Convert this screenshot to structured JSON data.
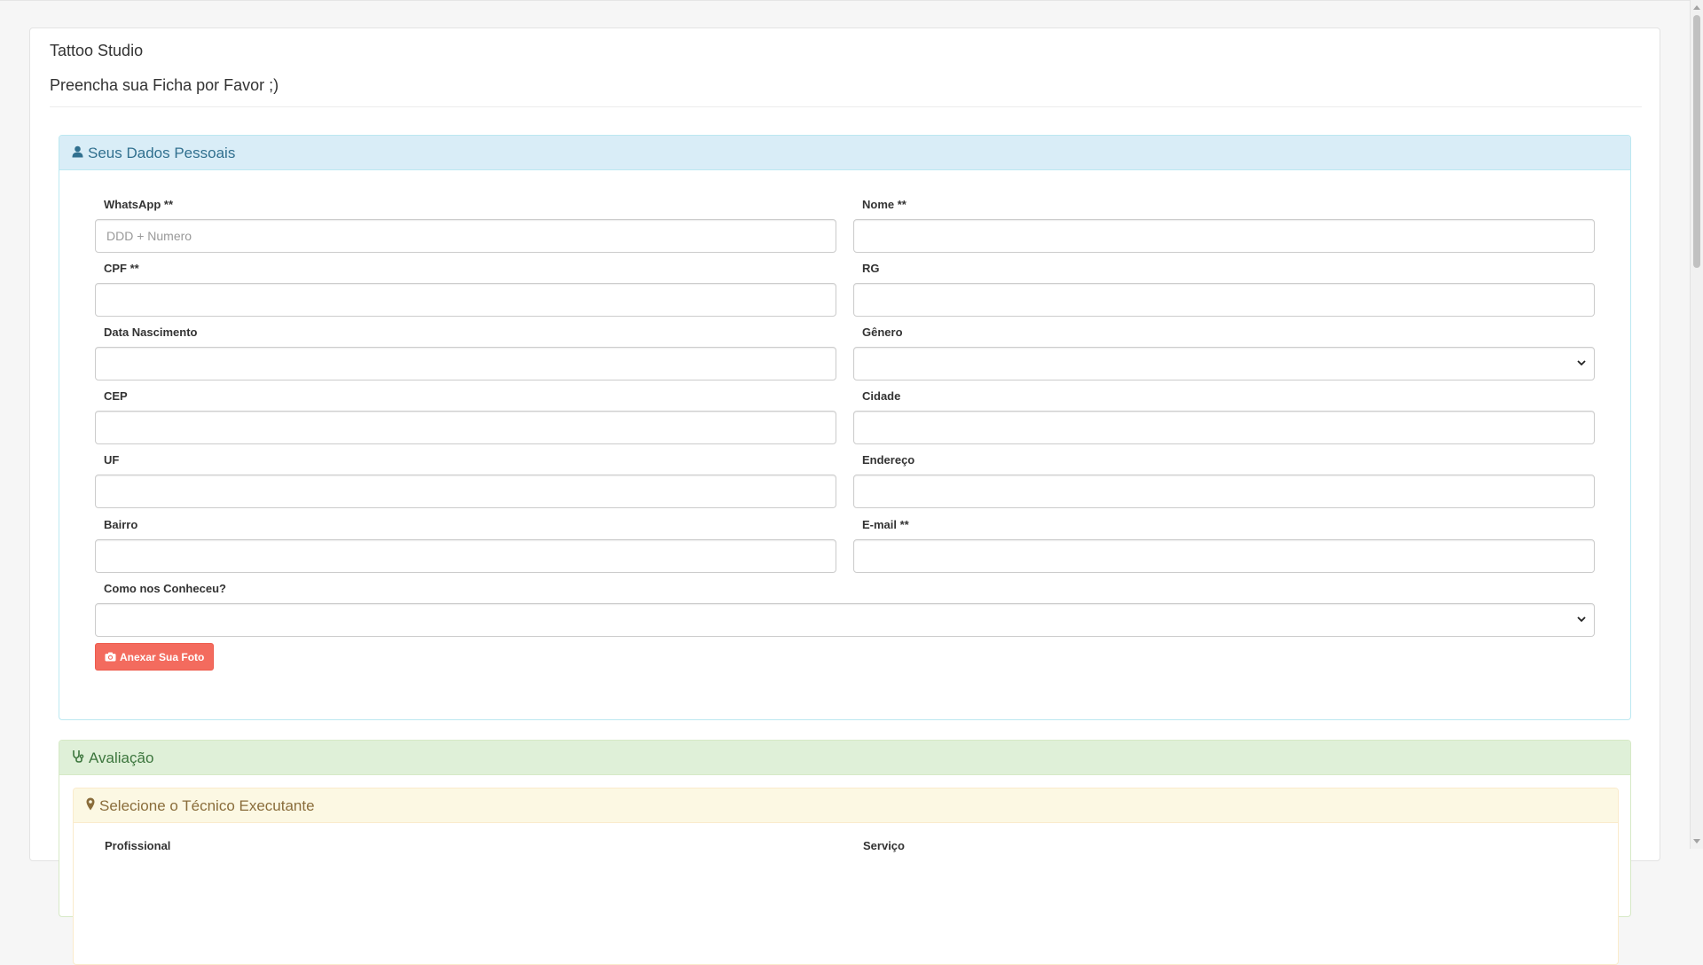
{
  "header": {
    "title": "Tattoo Studio",
    "subtitle": "Preencha sua Ficha por Favor ;)"
  },
  "personal_panel": {
    "title": "Seus Dados Pessoais",
    "icon": "user-icon",
    "fields": {
      "whatsapp": {
        "label": "WhatsApp **",
        "placeholder": "DDD + Numero",
        "value": ""
      },
      "nome": {
        "label": "Nome **",
        "value": ""
      },
      "cpf": {
        "label": "CPF **",
        "value": ""
      },
      "rg": {
        "label": "RG",
        "value": ""
      },
      "data_nascimento": {
        "label": "Data Nascimento",
        "value": ""
      },
      "genero": {
        "label": "Gênero",
        "selected": ""
      },
      "cep": {
        "label": "CEP",
        "value": ""
      },
      "cidade": {
        "label": "Cidade",
        "value": ""
      },
      "uf": {
        "label": "UF",
        "value": ""
      },
      "endereco": {
        "label": "Endereço",
        "value": ""
      },
      "bairro": {
        "label": "Bairro",
        "value": ""
      },
      "email": {
        "label": "E-mail **",
        "value": ""
      },
      "como_conheceu": {
        "label": "Como nos Conheceu?",
        "selected": ""
      }
    },
    "photo_button": {
      "label": "Anexar Sua Foto",
      "icon": "camera-icon"
    }
  },
  "evaluation_panel": {
    "title": "Avaliação",
    "icon": "stethoscope-icon",
    "technician_panel": {
      "title": "Selecione o Técnico Executante",
      "icon": "map-marker-icon",
      "labels": {
        "profissional": "Profissional",
        "servico": "Serviço"
      }
    }
  },
  "colors": {
    "info_bg": "#d9edf7",
    "info_text": "#31708f",
    "success_bg": "#dff0d8",
    "success_text": "#3c763d",
    "warning_bg": "#fcf8e3",
    "warning_text": "#8a6d3b",
    "danger_button": "#f36b5e"
  }
}
